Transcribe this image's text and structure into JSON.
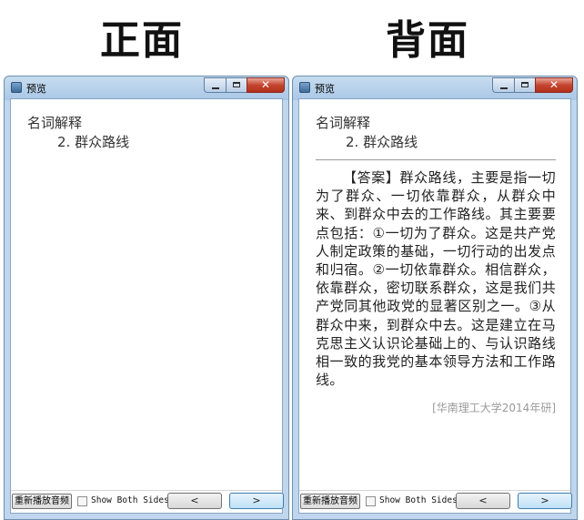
{
  "labels": {
    "front": "正面",
    "back": "背面"
  },
  "window": {
    "title": "预览",
    "close_glyph": "✕"
  },
  "card": {
    "heading": "名词解释",
    "item": "2. 群众路线",
    "answer": "【答案】群众路线，主要是指一切为了群众、一切依靠群众，从群众中来、到群众中去的工作路线。其主要要点包括：①一切为了群众。这是共产党人制定政策的基础，一切行动的出发点和归宿。②一切依靠群众。相信群众，依靠群众，密切联系群众，这是我们共产党同其他政党的显著区别之一。③从群众中来，到群众中去。这是建立在马克思主义认识论基础上的、与认识路线相一致的我党的基本领导方法和工作路线。",
    "source": "[华南理工大学2014年研]"
  },
  "bottombar": {
    "replay_label": "重新播放音频",
    "show_both_label": "Show Both Sides",
    "prev_label": "<",
    "next_label": ">"
  }
}
